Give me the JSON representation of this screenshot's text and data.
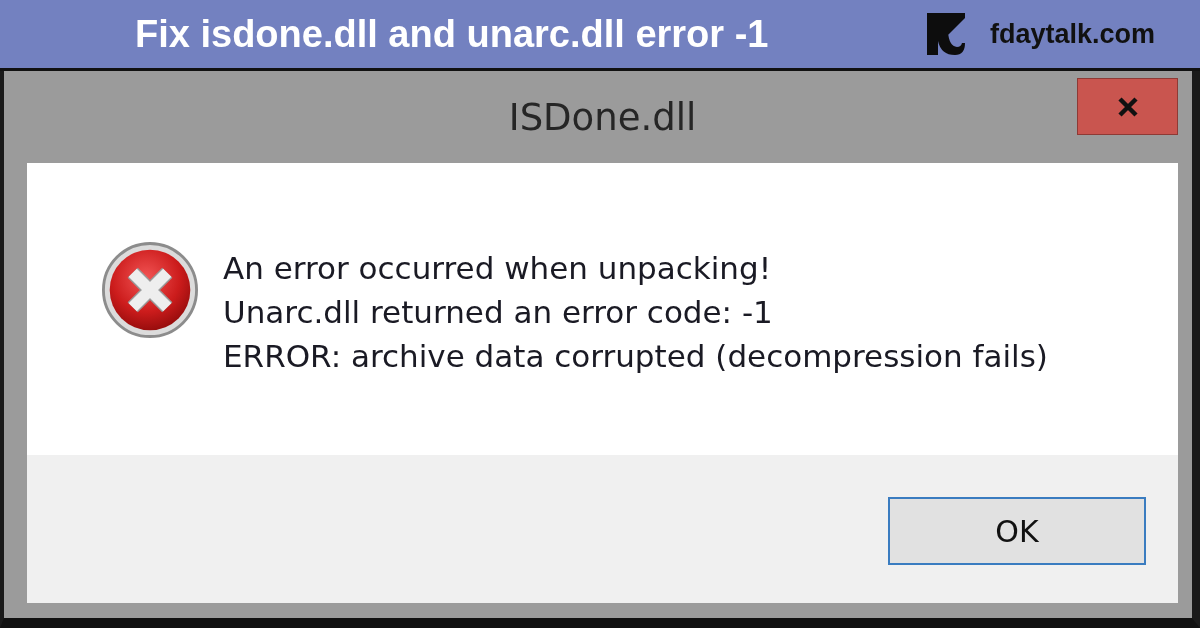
{
  "banner": {
    "title": "Fix isdone.dll and unarc.dll error -1",
    "site": "fdaytalk.com"
  },
  "dialog": {
    "title": "ISDone.dll",
    "message_lines": [
      "An error occurred when unpacking!",
      "Unarc.dll returned an error code: -1",
      "ERROR: archive data corrupted (decompression fails)"
    ],
    "buttons": [
      {
        "label": "OK",
        "default": true
      }
    ]
  }
}
